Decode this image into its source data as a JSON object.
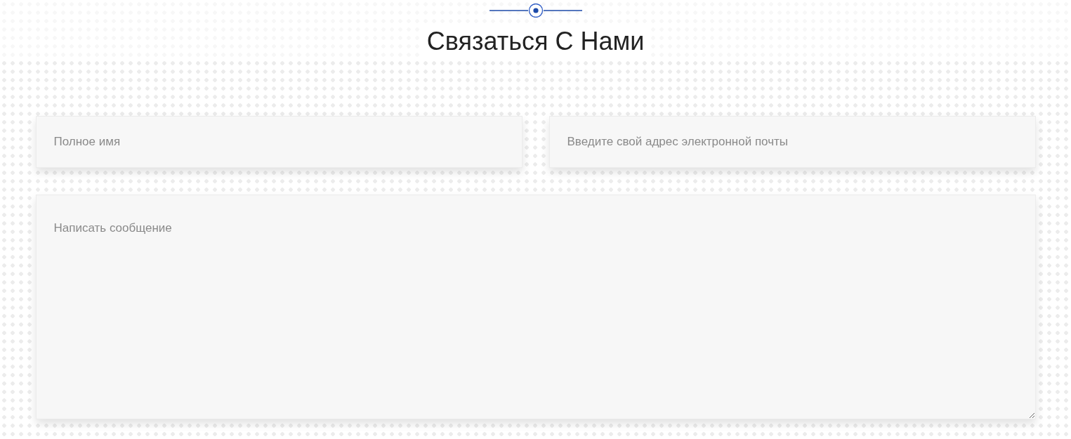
{
  "heading": "Связаться С Нами",
  "form": {
    "name_field": {
      "placeholder": "Полное имя"
    },
    "email_field": {
      "placeholder": "Введите свой адрес электронной почты"
    },
    "message_field": {
      "placeholder": "Написать сообщение"
    }
  }
}
